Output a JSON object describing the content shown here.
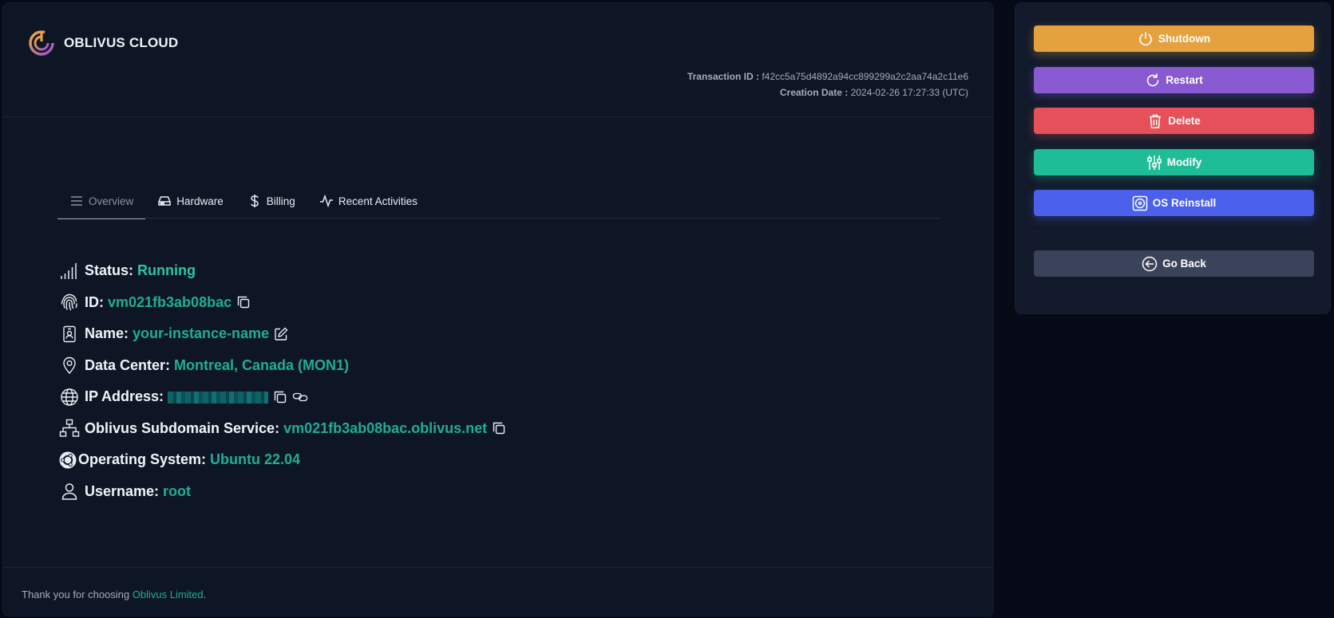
{
  "brand": {
    "name": "OBLIVUS CLOUD",
    "logo_icon": "oblivus-logo-icon"
  },
  "transaction": {
    "id_label": "Transaction ID :",
    "id_value": "f42cc5a75d4892a94cc899299a2c2aa74a2c11e6",
    "date_label": "Creation Date :",
    "date_value": "2024-02-26 17:27:33 (UTC)"
  },
  "tabs": [
    {
      "label": "Overview",
      "icon": "menu-lines-icon",
      "active": true
    },
    {
      "label": "Hardware",
      "icon": "hard-drive-icon",
      "active": false
    },
    {
      "label": "Billing",
      "icon": "dollar-icon",
      "active": false
    },
    {
      "label": "Recent Activities",
      "icon": "activity-pulse-icon",
      "active": false
    }
  ],
  "details": {
    "status": {
      "label": "Status:",
      "value": "Running",
      "icon": "signal-bars-icon"
    },
    "id": {
      "label": "ID:",
      "value": "vm021fb3ab08bac",
      "icon": "fingerprint-icon"
    },
    "name": {
      "label": "Name:",
      "value": "your-instance-name",
      "icon": "badge-person-icon"
    },
    "datacenter": {
      "label": "Data Center:",
      "value": "Montreal, Canada (MON1)",
      "icon": "map-pin-icon"
    },
    "ip": {
      "label": "IP Address:",
      "icon": "globe-icon"
    },
    "subdomain": {
      "label": "Oblivus Subdomain Service:",
      "value": "vm021fb3ab08bac.oblivus.net",
      "icon": "network-diagram-icon"
    },
    "os": {
      "label": "Operating System:",
      "value": "Ubuntu 22.04",
      "icon": "ubuntu-icon"
    },
    "username": {
      "label": "Username:",
      "value": "root",
      "icon": "user-icon"
    }
  },
  "footer": {
    "text": "Thank you for choosing ",
    "link": "Oblivus Limited",
    "suffix": "."
  },
  "actions": {
    "shutdown": "Shutdown",
    "restart": "Restart",
    "delete": "Delete",
    "modify": "Modify",
    "reinstall": "OS Reinstall",
    "back": "Go Back"
  },
  "colors": {
    "accent_teal": "#1fae95",
    "shutdown": "#e4a13e",
    "restart": "#8859d0",
    "delete": "#e5505a",
    "modify": "#1fbd97",
    "reinstall": "#4a5fea",
    "back": "#3b435a"
  }
}
